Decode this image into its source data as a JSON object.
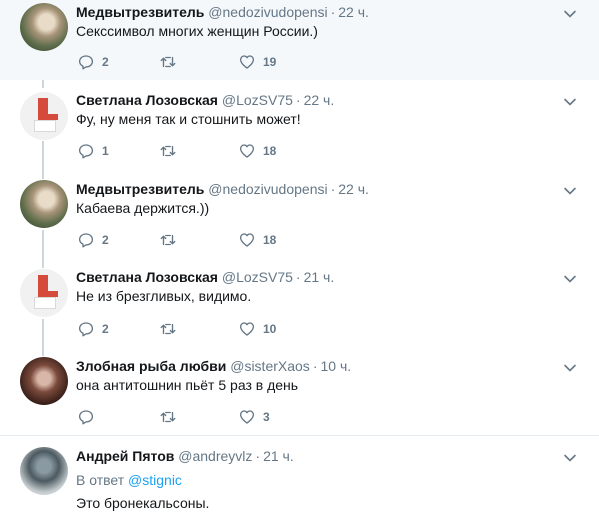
{
  "tweets": [
    {
      "name": "Медвытрезвитель",
      "handle": "@nedozivudopensi",
      "time": "22 ч.",
      "text": "Секссимвол многих женщин России.)",
      "replies": "2",
      "retweets": "",
      "likes": "19"
    },
    {
      "name": "Светлана Лозовская",
      "handle": "@LozSV75",
      "time": "22 ч.",
      "text": "Фу, ну меня так и стошнить может!",
      "replies": "1",
      "retweets": "",
      "likes": "18"
    },
    {
      "name": "Медвытрезвитель",
      "handle": "@nedozivudopensi",
      "time": "22 ч.",
      "text": "Кабаева держится.))",
      "replies": "2",
      "retweets": "",
      "likes": "18"
    },
    {
      "name": "Светлана Лозовская",
      "handle": "@LozSV75",
      "time": "21 ч.",
      "text": "Не из брезгливых, видимо.",
      "replies": "2",
      "retweets": "",
      "likes": "10"
    },
    {
      "name": "Злобная рыба любви",
      "handle": "@sisterXaos",
      "time": "10 ч.",
      "text": "она антитошнин пьёт 5 раз в день",
      "replies": "",
      "retweets": "",
      "likes": "3"
    },
    {
      "name": "Андрей Пятов",
      "handle": "@andreyvlz",
      "time": "21 ч.",
      "reply_prefix": "В ответ",
      "reply_to": "@stignic",
      "text": "Это бронекальсоны.",
      "replies": "",
      "retweets": "",
      "likes": ""
    }
  ],
  "separator": "·",
  "colors": {
    "accent": "#1da1f2",
    "muted": "#657786",
    "thread": "#ccd6dd",
    "highlight_bg": "#f5f8fa"
  }
}
